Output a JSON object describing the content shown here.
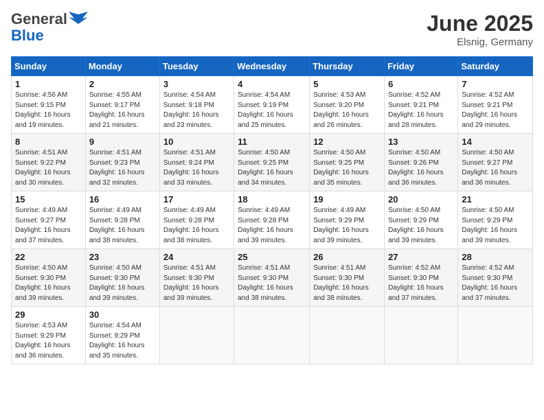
{
  "header": {
    "logo_general": "General",
    "logo_blue": "Blue",
    "month_year": "June 2025",
    "location": "Elsnig, Germany"
  },
  "days_of_week": [
    "Sunday",
    "Monday",
    "Tuesday",
    "Wednesday",
    "Thursday",
    "Friday",
    "Saturday"
  ],
  "weeks": [
    [
      {
        "day": "1",
        "sunrise": "Sunrise: 4:56 AM",
        "sunset": "Sunset: 9:15 PM",
        "daylight": "Daylight: 16 hours and 19 minutes."
      },
      {
        "day": "2",
        "sunrise": "Sunrise: 4:55 AM",
        "sunset": "Sunset: 9:17 PM",
        "daylight": "Daylight: 16 hours and 21 minutes."
      },
      {
        "day": "3",
        "sunrise": "Sunrise: 4:54 AM",
        "sunset": "Sunset: 9:18 PM",
        "daylight": "Daylight: 16 hours and 23 minutes."
      },
      {
        "day": "4",
        "sunrise": "Sunrise: 4:54 AM",
        "sunset": "Sunset: 9:19 PM",
        "daylight": "Daylight: 16 hours and 25 minutes."
      },
      {
        "day": "5",
        "sunrise": "Sunrise: 4:53 AM",
        "sunset": "Sunset: 9:20 PM",
        "daylight": "Daylight: 16 hours and 26 minutes."
      },
      {
        "day": "6",
        "sunrise": "Sunrise: 4:52 AM",
        "sunset": "Sunset: 9:21 PM",
        "daylight": "Daylight: 16 hours and 28 minutes."
      },
      {
        "day": "7",
        "sunrise": "Sunrise: 4:52 AM",
        "sunset": "Sunset: 9:21 PM",
        "daylight": "Daylight: 16 hours and 29 minutes."
      }
    ],
    [
      {
        "day": "8",
        "sunrise": "Sunrise: 4:51 AM",
        "sunset": "Sunset: 9:22 PM",
        "daylight": "Daylight: 16 hours and 30 minutes."
      },
      {
        "day": "9",
        "sunrise": "Sunrise: 4:51 AM",
        "sunset": "Sunset: 9:23 PM",
        "daylight": "Daylight: 16 hours and 32 minutes."
      },
      {
        "day": "10",
        "sunrise": "Sunrise: 4:51 AM",
        "sunset": "Sunset: 9:24 PM",
        "daylight": "Daylight: 16 hours and 33 minutes."
      },
      {
        "day": "11",
        "sunrise": "Sunrise: 4:50 AM",
        "sunset": "Sunset: 9:25 PM",
        "daylight": "Daylight: 16 hours and 34 minutes."
      },
      {
        "day": "12",
        "sunrise": "Sunrise: 4:50 AM",
        "sunset": "Sunset: 9:25 PM",
        "daylight": "Daylight: 16 hours and 35 minutes."
      },
      {
        "day": "13",
        "sunrise": "Sunrise: 4:50 AM",
        "sunset": "Sunset: 9:26 PM",
        "daylight": "Daylight: 16 hours and 36 minutes."
      },
      {
        "day": "14",
        "sunrise": "Sunrise: 4:50 AM",
        "sunset": "Sunset: 9:27 PM",
        "daylight": "Daylight: 16 hours and 36 minutes."
      }
    ],
    [
      {
        "day": "15",
        "sunrise": "Sunrise: 4:49 AM",
        "sunset": "Sunset: 9:27 PM",
        "daylight": "Daylight: 16 hours and 37 minutes."
      },
      {
        "day": "16",
        "sunrise": "Sunrise: 4:49 AM",
        "sunset": "Sunset: 9:28 PM",
        "daylight": "Daylight: 16 hours and 38 minutes."
      },
      {
        "day": "17",
        "sunrise": "Sunrise: 4:49 AM",
        "sunset": "Sunset: 9:28 PM",
        "daylight": "Daylight: 16 hours and 38 minutes."
      },
      {
        "day": "18",
        "sunrise": "Sunrise: 4:49 AM",
        "sunset": "Sunset: 9:28 PM",
        "daylight": "Daylight: 16 hours and 39 minutes."
      },
      {
        "day": "19",
        "sunrise": "Sunrise: 4:49 AM",
        "sunset": "Sunset: 9:29 PM",
        "daylight": "Daylight: 16 hours and 39 minutes."
      },
      {
        "day": "20",
        "sunrise": "Sunrise: 4:50 AM",
        "sunset": "Sunset: 9:29 PM",
        "daylight": "Daylight: 16 hours and 39 minutes."
      },
      {
        "day": "21",
        "sunrise": "Sunrise: 4:50 AM",
        "sunset": "Sunset: 9:29 PM",
        "daylight": "Daylight: 16 hours and 39 minutes."
      }
    ],
    [
      {
        "day": "22",
        "sunrise": "Sunrise: 4:50 AM",
        "sunset": "Sunset: 9:30 PM",
        "daylight": "Daylight: 16 hours and 39 minutes."
      },
      {
        "day": "23",
        "sunrise": "Sunrise: 4:50 AM",
        "sunset": "Sunset: 9:30 PM",
        "daylight": "Daylight: 16 hours and 39 minutes."
      },
      {
        "day": "24",
        "sunrise": "Sunrise: 4:51 AM",
        "sunset": "Sunset: 9:30 PM",
        "daylight": "Daylight: 16 hours and 39 minutes."
      },
      {
        "day": "25",
        "sunrise": "Sunrise: 4:51 AM",
        "sunset": "Sunset: 9:30 PM",
        "daylight": "Daylight: 16 hours and 38 minutes."
      },
      {
        "day": "26",
        "sunrise": "Sunrise: 4:51 AM",
        "sunset": "Sunset: 9:30 PM",
        "daylight": "Daylight: 16 hours and 38 minutes."
      },
      {
        "day": "27",
        "sunrise": "Sunrise: 4:52 AM",
        "sunset": "Sunset: 9:30 PM",
        "daylight": "Daylight: 16 hours and 37 minutes."
      },
      {
        "day": "28",
        "sunrise": "Sunrise: 4:52 AM",
        "sunset": "Sunset: 9:30 PM",
        "daylight": "Daylight: 16 hours and 37 minutes."
      }
    ],
    [
      {
        "day": "29",
        "sunrise": "Sunrise: 4:53 AM",
        "sunset": "Sunset: 9:29 PM",
        "daylight": "Daylight: 16 hours and 36 minutes."
      },
      {
        "day": "30",
        "sunrise": "Sunrise: 4:54 AM",
        "sunset": "Sunset: 9:29 PM",
        "daylight": "Daylight: 16 hours and 35 minutes."
      },
      null,
      null,
      null,
      null,
      null
    ]
  ]
}
